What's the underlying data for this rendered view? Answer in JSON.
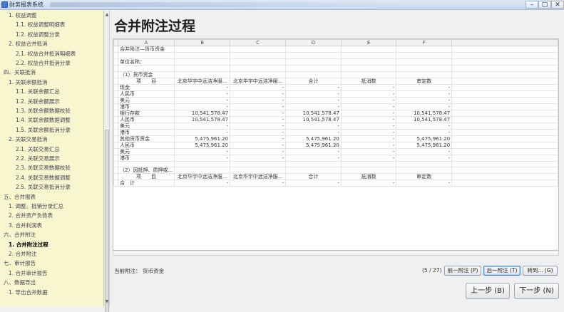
{
  "window": {
    "title": "财务报表系统",
    "controls": {
      "minimize": "–",
      "maximize": "▢",
      "close": "✕"
    }
  },
  "sidebar": {
    "items": [
      {
        "label": "1. 权益调整",
        "indent": 12,
        "active": false
      },
      {
        "label": "1.1. 权益调整明细表",
        "indent": 22,
        "active": false
      },
      {
        "label": "1.2. 权益调整分录",
        "indent": 22,
        "active": false
      },
      {
        "label": "2. 权益合并抵消",
        "indent": 12,
        "active": false
      },
      {
        "label": "2.1. 权益合并抵消明细表",
        "indent": 22,
        "active": false
      },
      {
        "label": "2.2. 权益合并抵消分录",
        "indent": 22,
        "active": false
      },
      {
        "label": "四、关联抵消",
        "indent": 5,
        "active": false
      },
      {
        "label": "1. 关联余额抵消",
        "indent": 12,
        "active": false
      },
      {
        "label": "1.1. 关联余额汇总",
        "indent": 22,
        "active": false
      },
      {
        "label": "1.2. 关联余额展示",
        "indent": 22,
        "active": false
      },
      {
        "label": "1.3. 关联余额数据校验",
        "indent": 22,
        "active": false
      },
      {
        "label": "1.4. 关联余额数据调整",
        "indent": 22,
        "active": false
      },
      {
        "label": "1.5. 关联余额抵消分录",
        "indent": 22,
        "active": false
      },
      {
        "label": "2. 关联交易抵消",
        "indent": 12,
        "active": false
      },
      {
        "label": "2.1. 关联交易汇总",
        "indent": 22,
        "active": false
      },
      {
        "label": "2.2. 关联交易展示",
        "indent": 22,
        "active": false
      },
      {
        "label": "2.3. 关联交易数据校验",
        "indent": 22,
        "active": false
      },
      {
        "label": "2.4. 关联交易数据调整",
        "indent": 22,
        "active": false
      },
      {
        "label": "2.5. 关联交易抵消分录",
        "indent": 22,
        "active": false
      },
      {
        "label": "五、合并报表",
        "indent": 5,
        "active": false
      },
      {
        "label": "1. 调整、抵销分录汇总",
        "indent": 12,
        "active": false
      },
      {
        "label": "2. 合并资产负债表",
        "indent": 12,
        "active": false
      },
      {
        "label": "3. 合并利润表",
        "indent": 12,
        "active": false
      },
      {
        "label": "六、合并附注",
        "indent": 5,
        "active": false
      },
      {
        "label": "1. 合并附注过程",
        "indent": 12,
        "active": true
      },
      {
        "label": "2. 合并附注",
        "indent": 12,
        "active": false
      },
      {
        "label": "七、审计报告",
        "indent": 5,
        "active": false
      },
      {
        "label": "1. 合并审计报告",
        "indent": 12,
        "active": false
      },
      {
        "label": "八、数据导出",
        "indent": 5,
        "active": false
      },
      {
        "label": "1. 导出合并数据",
        "indent": 12,
        "active": false
      }
    ]
  },
  "main": {
    "title": "合并附注过程",
    "sheet": {
      "columns": [
        "",
        "A",
        "B",
        "C",
        "D",
        "E",
        "F",
        ""
      ],
      "rows": [
        [
          "合并附注—货币资金",
          "",
          "",
          "",
          "",
          "",
          ""
        ],
        [
          "",
          "",
          "",
          "",
          "",
          "",
          ""
        ],
        [
          "单位名称：",
          "",
          "",
          "",
          "",
          "",
          ""
        ],
        [
          "",
          "",
          "",
          "",
          "",
          "",
          ""
        ],
        [
          "（1）货币资金",
          "",
          "",
          "",
          "",
          "",
          ""
        ],
        [
          "项　　目",
          "北京华宇中远洁净服...",
          "北京华宇中远洁净服...",
          "合计",
          "抵消数",
          "审定数",
          ""
        ],
        [
          "现金",
          "-",
          "-",
          "-",
          "-",
          "-",
          ""
        ],
        [
          "人民币",
          "-",
          "-",
          "-",
          "-",
          "-",
          ""
        ],
        [
          "美元",
          "-",
          "-",
          "-",
          "-",
          "-",
          ""
        ],
        [
          "港币",
          "-",
          "-",
          "-",
          "-",
          "-",
          ""
        ],
        [
          "银行存款",
          "10,541,578.47",
          "-",
          "10,541,578.47",
          "-",
          "10,541,578.47",
          ""
        ],
        [
          "人民币",
          "10,541,578.47",
          "-",
          "10,541,578.47",
          "-",
          "10,541,578.47",
          ""
        ],
        [
          "美元",
          "-",
          "-",
          "-",
          "-",
          "-",
          ""
        ],
        [
          "港币",
          "-",
          "-",
          "-",
          "-",
          "-",
          ""
        ],
        [
          "其他货币资金",
          "5,475,961.20",
          "-",
          "5,475,961.20",
          "-",
          "5,475,961.20",
          ""
        ],
        [
          "人民币",
          "5,475,961.20",
          "-",
          "5,475,961.20",
          "-",
          "5,475,961.20",
          ""
        ],
        [
          "美元",
          "-",
          "-",
          "-",
          "-",
          "-",
          ""
        ],
        [
          "港币",
          "-",
          "-",
          "-",
          "-",
          "-",
          ""
        ],
        [
          "",
          "",
          "",
          "",
          "",
          "",
          ""
        ],
        [
          "（2）因抵押、质押或...",
          "",
          "",
          "",
          "",
          "",
          ""
        ],
        [
          "项　　目",
          "北京华宇中远洁净服...",
          "北京华宇中远洁净服...",
          "合计",
          "抵消数",
          "审定数",
          ""
        ],
        [
          "合　计",
          "-",
          "-",
          "-",
          "-",
          "-",
          ""
        ]
      ]
    }
  },
  "footer": {
    "current_label": "当前附注：",
    "current_value": "货币资金",
    "page_count": "(5 / 27)",
    "prev_note": "前一附注 (P)",
    "next_note": "后一附注 (T)",
    "jump": "转到... (G)",
    "prev_step": "上一步 (B)",
    "next_step": "下一步 (N)"
  }
}
